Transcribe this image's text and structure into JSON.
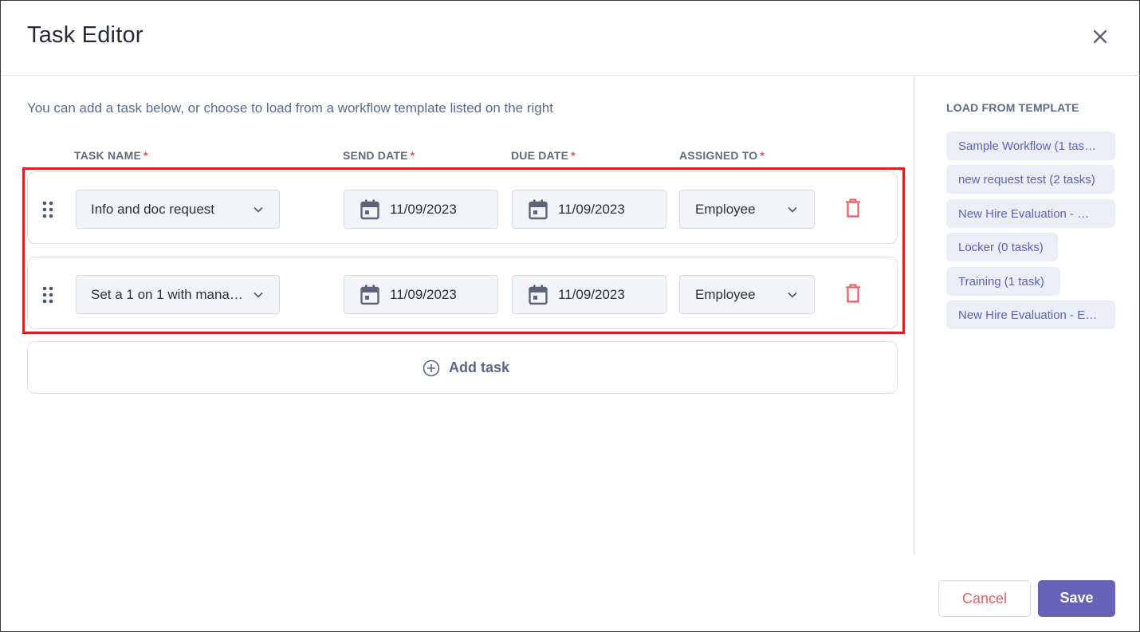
{
  "window": {
    "title": "Task Editor"
  },
  "intro_text": "You can add a task below, or choose to load from a workflow template listed on the right",
  "columns": {
    "task_name": "TASK NAME",
    "send_date": "SEND DATE",
    "due_date": "DUE DATE",
    "assigned_to": "ASSIGNED TO",
    "required_marker": "*"
  },
  "tasks": [
    {
      "name": "Info and doc request",
      "send_date": "11/09/2023",
      "due_date": "11/09/2023",
      "assigned_to": "Employee"
    },
    {
      "name": "Set a 1 on 1 with mana…",
      "send_date": "11/09/2023",
      "due_date": "11/09/2023",
      "assigned_to": "Employee"
    }
  ],
  "add_task_label": "Add task",
  "templates": {
    "heading": "LOAD FROM TEMPLATE",
    "items": [
      "Sample Workflow (1 tas…",
      "new request test (2 tasks)",
      "New Hire Evaluation - …",
      "Locker (0 tasks)",
      "Training (1 task)",
      "New Hire Evaluation - E…"
    ]
  },
  "footer": {
    "cancel_label": "Cancel",
    "save_label": "Save"
  },
  "icons": {
    "close": "close-icon",
    "drag": "drag-handle-icon",
    "calendar": "calendar-icon",
    "chevron": "chevron-down-icon",
    "trash": "trash-icon",
    "add": "plus-circle-icon"
  },
  "colors": {
    "accent": "#6562b7",
    "danger": "#ea5a62",
    "highlight": "#e31b23",
    "chip_text": "#5b64b3"
  }
}
